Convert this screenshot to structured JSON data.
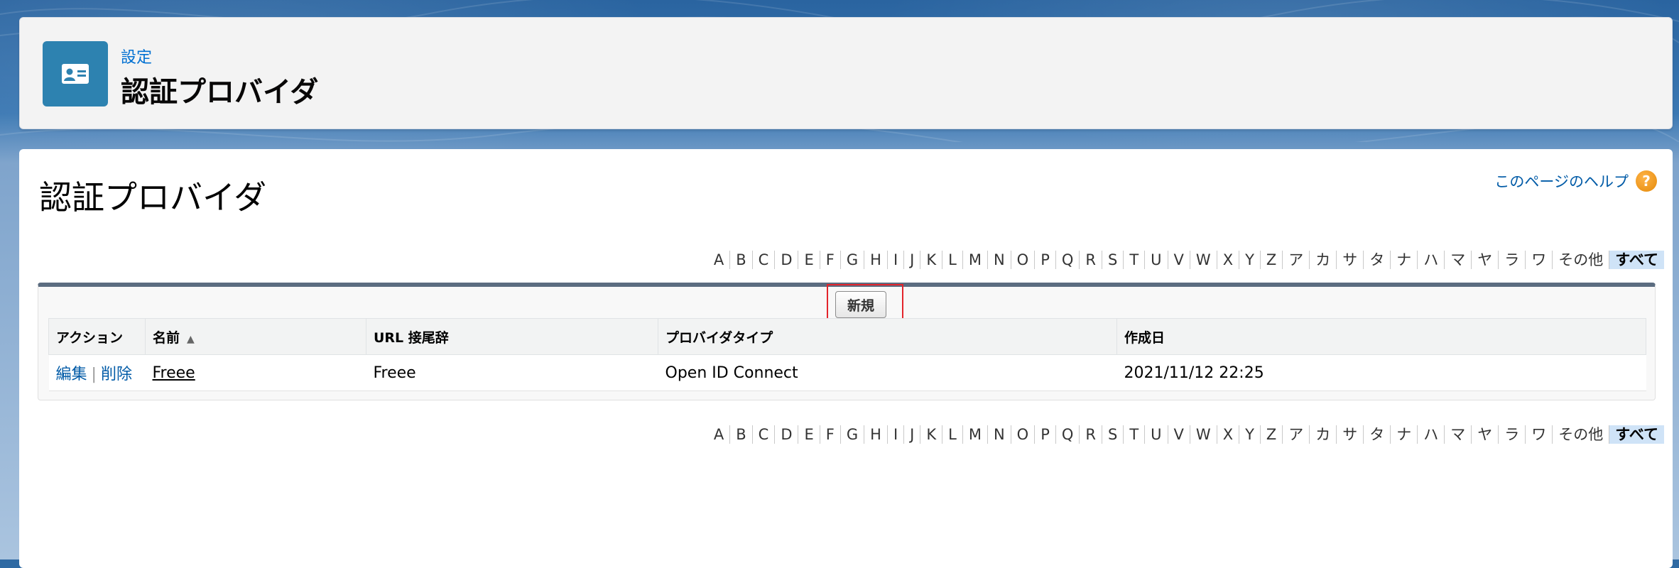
{
  "header": {
    "breadcrumb": "設定",
    "title": "認証プロバイダ",
    "icon": "contact-card-icon",
    "icon_color": "#2d82b0"
  },
  "main": {
    "title": "認証プロバイダ",
    "help_link": "このページのヘルプ",
    "help_icon": "question-icon"
  },
  "alphabet": [
    "A",
    "B",
    "C",
    "D",
    "E",
    "F",
    "G",
    "H",
    "I",
    "J",
    "K",
    "L",
    "M",
    "N",
    "O",
    "P",
    "Q",
    "R",
    "S",
    "T",
    "U",
    "V",
    "W",
    "X",
    "Y",
    "Z",
    "ア",
    "カ",
    "サ",
    "タ",
    "ナ",
    "ハ",
    "マ",
    "ヤ",
    "ラ",
    "ワ",
    "その他",
    "すべて"
  ],
  "alphabet_selected": "すべて",
  "list": {
    "new_button": "新規",
    "columns": [
      "アクション",
      "名前",
      "URL 接尾辞",
      "プロバイダタイプ",
      "作成日"
    ],
    "sort_icon": "arrow-up-icon",
    "rows": [
      {
        "edit": "編集",
        "separator": "|",
        "delete": "削除",
        "name": "Freee",
        "url_suffix": "Freee",
        "provider_type": "Open ID Connect",
        "created": "2021/11/12 22:25"
      }
    ]
  },
  "colors": {
    "link": "#015ba7",
    "highlight": "#e3242b",
    "selected_letter_bg": "#cfe3f7"
  }
}
